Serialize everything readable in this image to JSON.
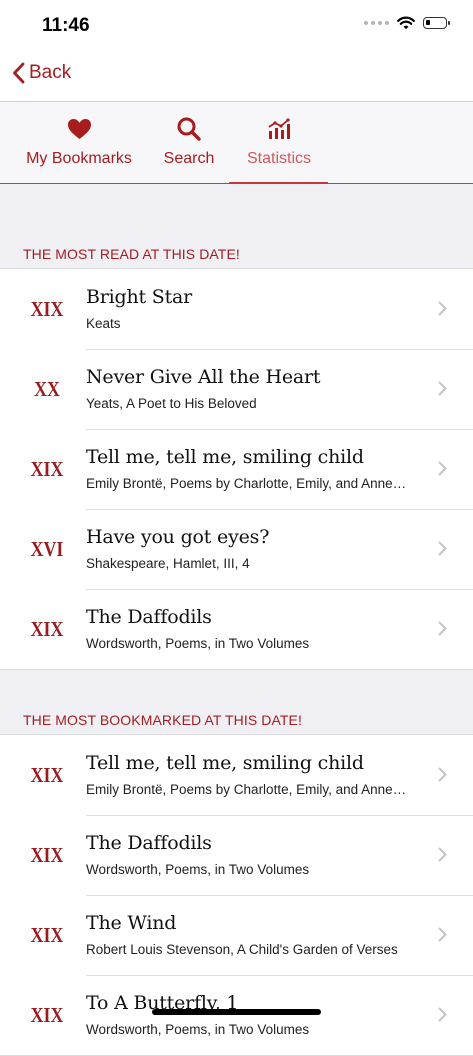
{
  "status_bar": {
    "time": "11:46"
  },
  "nav": {
    "back_label": "Back"
  },
  "tabs": [
    {
      "label": "My Bookmarks",
      "icon": "heart-icon"
    },
    {
      "label": "Search",
      "icon": "search-icon"
    },
    {
      "label": "Statistics",
      "icon": "chart-icon",
      "active": true
    }
  ],
  "sections": {
    "most_read": {
      "title": "THE MOST READ AT THIS DATE!",
      "items": [
        {
          "century": "XIX",
          "title": "Bright Star",
          "meta": "Keats"
        },
        {
          "century": "XX",
          "title": "Never Give All the Heart",
          "meta": "Yeats, A Poet to His Beloved"
        },
        {
          "century": "XIX",
          "title": "Tell me, tell me, smiling child",
          "meta": "Emily Brontë, Poems by Charlotte, Emily, and Anne…"
        },
        {
          "century": "XVI",
          "title": "Have you got eyes?",
          "meta": "Shakespeare, Hamlet, III, 4"
        },
        {
          "century": "XIX",
          "title": "The Daffodils",
          "meta": "Wordsworth, Poems, in Two Volumes"
        }
      ]
    },
    "most_bookmarked": {
      "title": "THE MOST BOOKMARKED AT THIS DATE!",
      "items": [
        {
          "century": "XIX",
          "title": "Tell me, tell me, smiling child",
          "meta": "Emily Brontë, Poems by Charlotte, Emily, and Anne…"
        },
        {
          "century": "XIX",
          "title": "The Daffodils",
          "meta": "Wordsworth, Poems, in Two Volumes"
        },
        {
          "century": "XIX",
          "title": "The Wind",
          "meta": "Robert Louis Stevenson, A Child's Garden of Verses"
        },
        {
          "century": "XIX",
          "title": "To A Butterfly, 1",
          "meta": "Wordsworth, Poems, in Two Volumes"
        }
      ]
    }
  },
  "colors": {
    "accent": "#a61d20",
    "accent_light": "#cf5a5a",
    "background": "#efeff4"
  }
}
